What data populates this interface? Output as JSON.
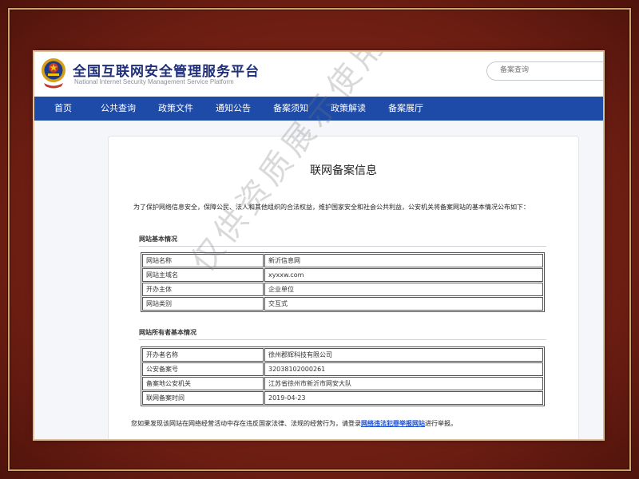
{
  "header": {
    "title": "全国互联网安全管理服务平台",
    "subtitle": "National Internet Security Management Service Platform",
    "search_placeholder": "备案查询"
  },
  "nav": {
    "items": [
      "首页",
      "公共查询",
      "政策文件",
      "通知公告",
      "备案须知",
      "政策解读",
      "备案展厅"
    ]
  },
  "main": {
    "title": "联网备案信息",
    "intro": "为了保护网络信息安全，保障公民、法人和其他组织的合法权益，维护国家安全和社会公共利益，公安机关将备案网站的基本情况公布如下：",
    "section1": {
      "title": "网站基本情况",
      "rows": [
        {
          "label": "网站名称",
          "value": "新沂信息网"
        },
        {
          "label": "网站主域名",
          "value": "xyxxw.com"
        },
        {
          "label": "开办主体",
          "value": "企业单位"
        },
        {
          "label": "网站类别",
          "value": "交互式"
        }
      ]
    },
    "section2": {
      "title": "网站所有者基本情况",
      "rows": [
        {
          "label": "开办者名称",
          "value": "徐州郡辉科技有限公司"
        },
        {
          "label": "公安备案号",
          "value": "32038102000261"
        },
        {
          "label": "备案地公安机关",
          "value": "江苏省徐州市新沂市网安大队"
        },
        {
          "label": "联网备案时间",
          "value": "2019-04-23"
        }
      ]
    },
    "report": {
      "prefix": "您如果发现该网站在网络经营活动中存在违反国家法律、法规的经营行为，请登录",
      "link": "网络违法犯罪举报网站",
      "suffix": "进行举报。"
    }
  },
  "watermark": "仅供资质展示使用",
  "colors": {
    "nav_bg": "#1e4aa8",
    "title_blue": "#1f2f7a",
    "frame": "#7a2418"
  }
}
